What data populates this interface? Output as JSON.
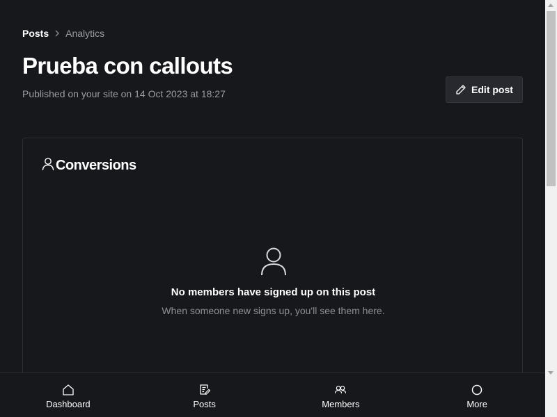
{
  "breadcrumb": {
    "parent": "Posts",
    "current": "Analytics"
  },
  "post": {
    "title": "Prueba con callouts",
    "published": "Published on your site on 14 Oct 2023 at 18:27",
    "edit_label": "Edit post"
  },
  "conversions": {
    "title": "Conversions",
    "icon": "user-icon",
    "empty_title": "No members have signed up on this post",
    "empty_subtitle": "When someone new signs up, you'll see them here."
  },
  "bottom_nav": {
    "items": [
      {
        "label": "Dashboard",
        "icon": "home-icon"
      },
      {
        "label": "Posts",
        "icon": "posts-icon"
      },
      {
        "label": "Members",
        "icon": "members-icon"
      },
      {
        "label": "More",
        "icon": "circle-icon"
      }
    ]
  },
  "colors": {
    "background": "#17181c",
    "text_primary": "#ffffff",
    "text_muted": "#9a9ca3",
    "border": "#2c2e33",
    "button_bg": "#27292e"
  }
}
